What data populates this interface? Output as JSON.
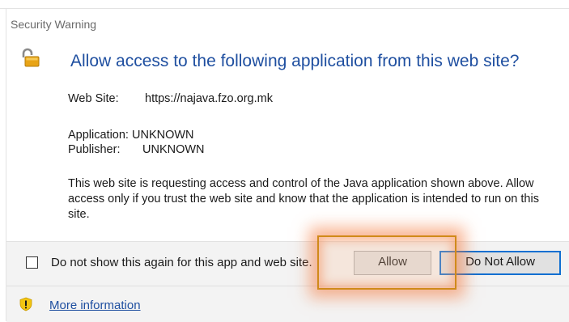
{
  "dialog": {
    "title": "Security Warning",
    "heading": "Allow access to the following application from this web site?",
    "website_label": "Web Site:",
    "website_value": "https://najava.fzo.org.mk",
    "application_label": "Application:",
    "application_value": "UNKNOWN",
    "publisher_label": "Publisher:",
    "publisher_value": "UNKNOWN",
    "description": "This web site is requesting access and control of the Java application shown above. Allow access only if you trust the web site and know that the application is intended to run on this site.",
    "icons": {
      "lock": "padlock-unlocked-icon",
      "info": "shield-warning-icon"
    }
  },
  "footer": {
    "checkbox_label": "Do not show this again for this app and web site.",
    "allow_label": "Allow",
    "deny_label": "Do Not Allow",
    "more_info_label": "More information"
  },
  "colors": {
    "heading": "#1f4fa0",
    "highlight": "#f4783c",
    "default_button_border": "#0f6fd1"
  }
}
